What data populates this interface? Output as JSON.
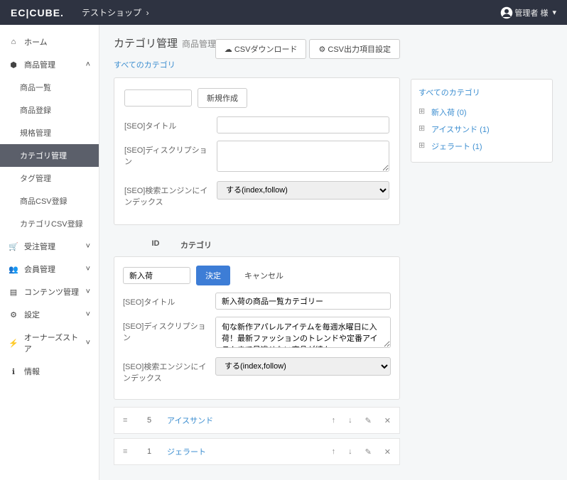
{
  "header": {
    "logo": "EC|CUBE.",
    "shop_name": "テストショップ",
    "user_label": "管理者 様"
  },
  "sidebar": {
    "items": [
      {
        "label": "ホーム",
        "icon": "home",
        "expandable": false
      },
      {
        "label": "商品管理",
        "icon": "cube",
        "expandable": true,
        "open": true,
        "children": [
          {
            "label": "商品一覧"
          },
          {
            "label": "商品登録"
          },
          {
            "label": "規格管理"
          },
          {
            "label": "カテゴリ管理",
            "active": true
          },
          {
            "label": "タグ管理"
          },
          {
            "label": "商品CSV登録"
          },
          {
            "label": "カテゴリCSV登録"
          }
        ]
      },
      {
        "label": "受注管理",
        "icon": "cart",
        "expandable": true
      },
      {
        "label": "会員管理",
        "icon": "users",
        "expandable": true
      },
      {
        "label": "コンテンツ管理",
        "icon": "file",
        "expandable": true
      },
      {
        "label": "設定",
        "icon": "gear",
        "expandable": true
      },
      {
        "label": "オーナーズストア",
        "icon": "plug",
        "expandable": true
      },
      {
        "label": "情報",
        "icon": "info",
        "expandable": false
      }
    ]
  },
  "page": {
    "title": "カテゴリ管理",
    "subtitle": "商品管理",
    "breadcrumb": "すべてのカテゴリ"
  },
  "toolbar": {
    "csv_download": "CSVダウンロード",
    "csv_settings": "CSV出力項目設定"
  },
  "new_form": {
    "name_value": "",
    "create_btn": "新規作成",
    "seo_title_label": "[SEO]タイトル",
    "seo_desc_label": "[SEO]ディスクリプション",
    "seo_index_label": "[SEO]検索エンジンにインデックス",
    "seo_title_value": "",
    "seo_desc_value": "",
    "seo_index_option": "する(index,follow)"
  },
  "list": {
    "header_id": "ID",
    "header_cat": "カテゴリ"
  },
  "edit": {
    "name_value": "新入荷",
    "submit": "決定",
    "cancel": "キャンセル",
    "seo_title_label": "[SEO]タイトル",
    "seo_title_value": "新入荷の商品一覧カテゴリー",
    "seo_desc_label": "[SEO]ディスクリプション",
    "seo_desc_value": "旬な新作アパレルアイテムを毎週水曜日に入荷！最新ファッションのトレンドや定番アイテムまで見逃せない商品が続々",
    "seo_index_label": "[SEO]検索エンジンにインデックス",
    "seo_index_option": "する(index,follow)"
  },
  "categories": [
    {
      "id": "5",
      "name": "アイスサンド"
    },
    {
      "id": "1",
      "name": "ジェラート"
    }
  ],
  "tree": {
    "title": "すべてのカテゴリ",
    "items": [
      {
        "label": "新入荷 (0)"
      },
      {
        "label": "アイスサンド (1)"
      },
      {
        "label": "ジェラート (1)"
      }
    ]
  }
}
